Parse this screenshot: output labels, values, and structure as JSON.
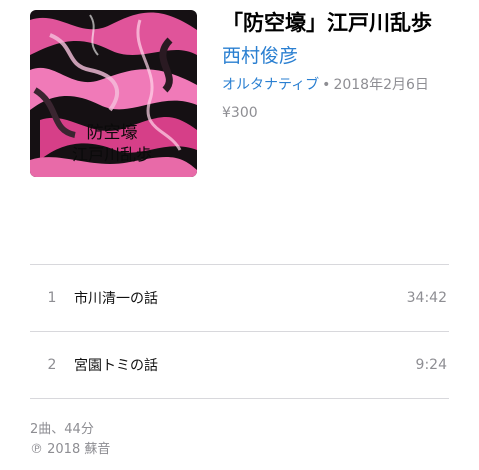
{
  "album": {
    "title": "「防空壕」江戸川乱歩",
    "artist": "西村俊彦",
    "genre": "オルタナティブ",
    "separator": "•",
    "release_date": "2018年2月6日",
    "price": "¥300",
    "artwork_text_line1": "防空壕",
    "artwork_text_line2": "江戸川乱歩"
  },
  "tracks": [
    {
      "number": "1",
      "title": "市川清一の話",
      "duration": "34:42"
    },
    {
      "number": "2",
      "title": "宮園トミの話",
      "duration": "9:24"
    }
  ],
  "footer": {
    "summary": "2曲、44分",
    "copyright": "℗ 2018 蘇音"
  },
  "colors": {
    "accent": "#2a7fd1",
    "secondary_text": "#8e8e93",
    "divider": "#d8d8dc",
    "artwork_pink": "#e0549a",
    "artwork_dark": "#151013"
  }
}
